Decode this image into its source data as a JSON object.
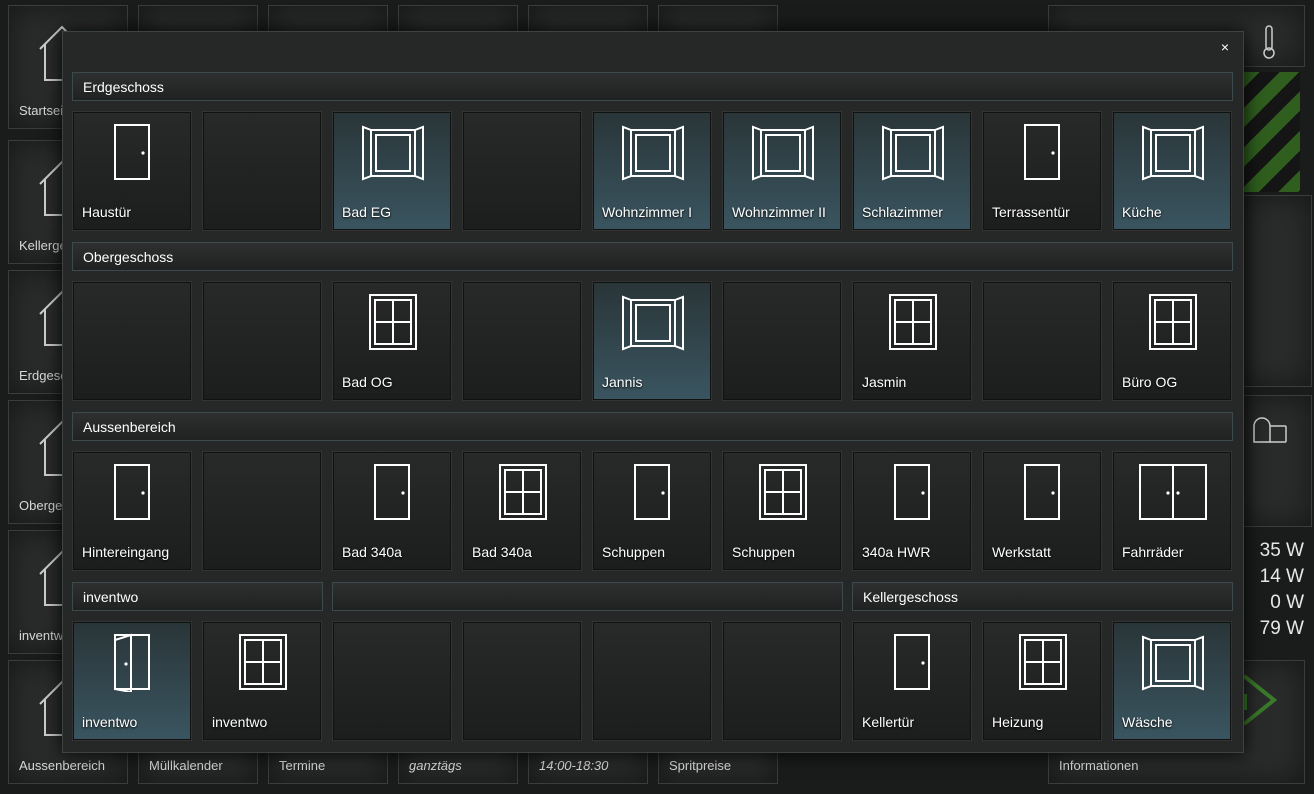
{
  "background": {
    "sidebar": [
      {
        "label": "Startseite"
      },
      {
        "label": "Kellergeschoss"
      },
      {
        "label": "Erdgeschoss"
      },
      {
        "label": "Obergeschoss"
      },
      {
        "label": "inventwo"
      },
      {
        "label": "Aussenbereich"
      }
    ],
    "bottom_row": [
      "Müllkalender",
      "Termine",
      "ganztägs",
      "14:00-18:30",
      "Spritpreise",
      "Informationen"
    ],
    "power_values": [
      "35 W",
      "14 W",
      "0 W",
      "79 W"
    ],
    "accent_color": "#3a7a2a"
  },
  "modal": {
    "close_label": "×",
    "sections": [
      {
        "title": "Erdgeschoss"
      },
      {
        "title": "Obergeschoss"
      },
      {
        "title": "Aussenbereich"
      },
      {
        "title": "inventwo"
      },
      {
        "title": ""
      },
      {
        "title": "Kellergeschoss"
      }
    ],
    "tiles": [
      [
        {
          "label": "Haustür",
          "icon": "door-icon",
          "state": "closed"
        },
        {
          "label": "",
          "icon": "",
          "state": "empty"
        },
        {
          "label": "Bad EG",
          "icon": "window-open-icon",
          "state": "open"
        },
        {
          "label": "",
          "icon": "",
          "state": "empty"
        },
        {
          "label": "Wohnzimmer I",
          "icon": "window-open-icon",
          "state": "open"
        },
        {
          "label": "Wohnzimmer II",
          "icon": "window-open-icon",
          "state": "open"
        },
        {
          "label": "Schlazimmer",
          "icon": "window-open-icon",
          "state": "open"
        },
        {
          "label": "Terrassentür",
          "icon": "door-icon",
          "state": "closed"
        },
        {
          "label": "Küche",
          "icon": "window-open-icon",
          "state": "open"
        }
      ],
      [
        {
          "label": "",
          "icon": "",
          "state": "empty"
        },
        {
          "label": "",
          "icon": "",
          "state": "empty"
        },
        {
          "label": "Bad OG",
          "icon": "window-closed-icon",
          "state": "closed"
        },
        {
          "label": "",
          "icon": "",
          "state": "empty"
        },
        {
          "label": "Jannis",
          "icon": "window-open-icon",
          "state": "open"
        },
        {
          "label": "",
          "icon": "",
          "state": "empty"
        },
        {
          "label": "Jasmin",
          "icon": "window-closed-icon",
          "state": "closed"
        },
        {
          "label": "",
          "icon": "",
          "state": "empty"
        },
        {
          "label": "Büro OG",
          "icon": "window-closed-icon",
          "state": "closed"
        }
      ],
      [
        {
          "label": "Hintereingang",
          "icon": "door-icon",
          "state": "closed"
        },
        {
          "label": "",
          "icon": "",
          "state": "empty"
        },
        {
          "label": "Bad 340a",
          "icon": "door-icon",
          "state": "closed"
        },
        {
          "label": "Bad 340a",
          "icon": "window-closed-icon",
          "state": "closed"
        },
        {
          "label": "Schuppen",
          "icon": "door-icon",
          "state": "closed"
        },
        {
          "label": "Schuppen",
          "icon": "window-closed-icon",
          "state": "closed"
        },
        {
          "label": "340a HWR",
          "icon": "door-icon",
          "state": "closed"
        },
        {
          "label": "Werkstatt",
          "icon": "door-icon",
          "state": "closed"
        },
        {
          "label": "Fahrräder",
          "icon": "double-door-icon",
          "state": "closed"
        }
      ],
      [
        {
          "label": "inventwo",
          "icon": "door-open-icon",
          "state": "open"
        },
        {
          "label": "inventwo",
          "icon": "window-closed-icon",
          "state": "closed"
        },
        {
          "label": "",
          "icon": "",
          "state": "empty"
        },
        {
          "label": "",
          "icon": "",
          "state": "empty"
        },
        {
          "label": "",
          "icon": "",
          "state": "empty"
        },
        {
          "label": "",
          "icon": "",
          "state": "empty"
        },
        {
          "label": "Kellertür",
          "icon": "door-icon",
          "state": "closed"
        },
        {
          "label": "Heizung",
          "icon": "window-closed-icon",
          "state": "closed"
        },
        {
          "label": "Wäsche",
          "icon": "window-open-icon",
          "state": "open"
        }
      ]
    ]
  }
}
